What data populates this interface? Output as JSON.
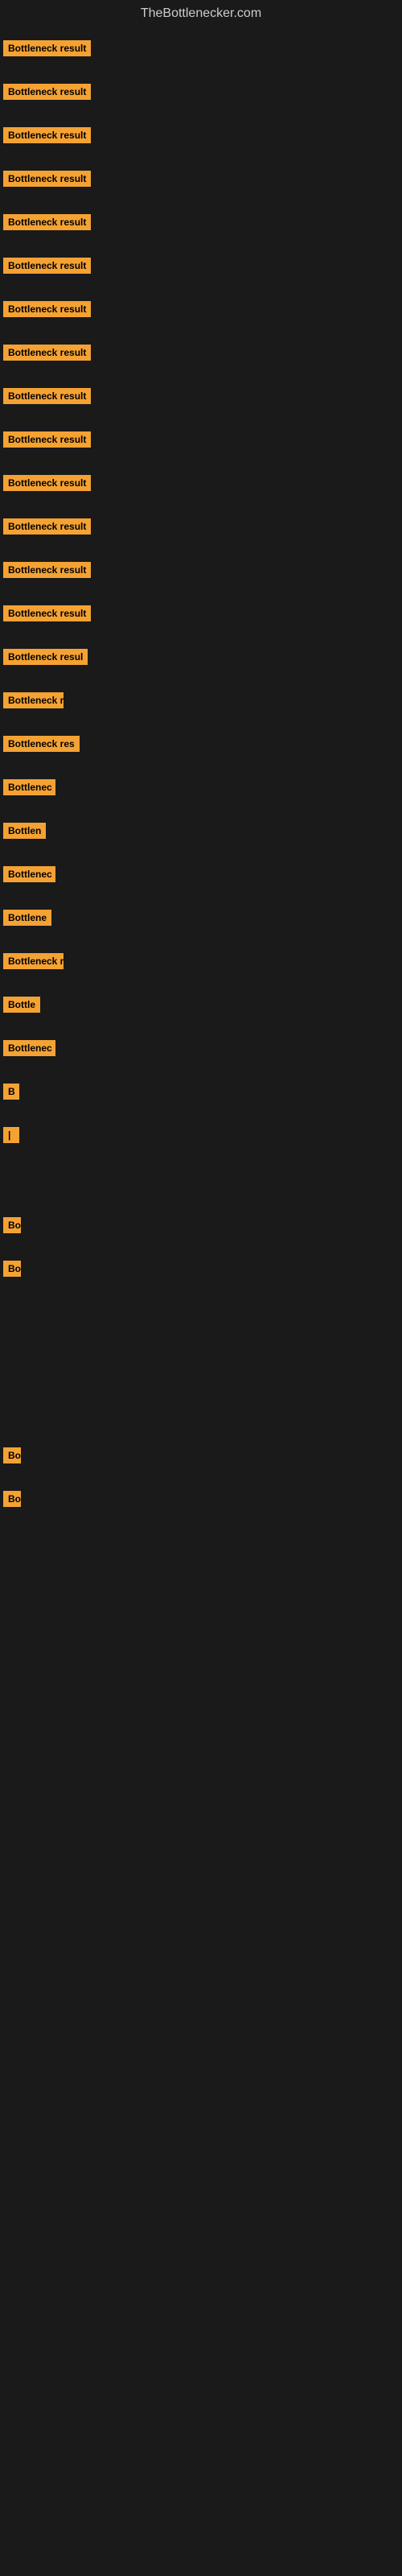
{
  "site": {
    "title": "TheBottlenecker.com"
  },
  "items": [
    {
      "id": 1,
      "label": "Bottleneck result",
      "width": "full",
      "row_class": "row-1"
    },
    {
      "id": 2,
      "label": "Bottleneck result",
      "width": "full",
      "row_class": "row-2"
    },
    {
      "id": 3,
      "label": "Bottleneck result",
      "width": "full",
      "row_class": "row-3"
    },
    {
      "id": 4,
      "label": "Bottleneck result",
      "width": "full",
      "row_class": "row-4"
    },
    {
      "id": 5,
      "label": "Bottleneck result",
      "width": "full",
      "row_class": "row-5"
    },
    {
      "id": 6,
      "label": "Bottleneck result",
      "width": "full",
      "row_class": "row-6"
    },
    {
      "id": 7,
      "label": "Bottleneck result",
      "width": "full",
      "row_class": "row-7"
    },
    {
      "id": 8,
      "label": "Bottleneck result",
      "width": "full",
      "row_class": "row-8"
    },
    {
      "id": 9,
      "label": "Bottleneck result",
      "width": "full",
      "row_class": "row-9"
    },
    {
      "id": 10,
      "label": "Bottleneck result",
      "width": "full",
      "row_class": "row-10"
    },
    {
      "id": 11,
      "label": "Bottleneck result",
      "width": "full",
      "row_class": "row-11"
    },
    {
      "id": 12,
      "label": "Bottleneck result",
      "width": "full",
      "row_class": "row-12"
    },
    {
      "id": 13,
      "label": "Bottleneck result",
      "width": "full",
      "row_class": "row-13"
    },
    {
      "id": 14,
      "label": "Bottleneck result",
      "width": "full",
      "row_class": "row-14"
    },
    {
      "id": 15,
      "label": "Bottleneck resul",
      "width": "partial",
      "row_class": "row-15"
    },
    {
      "id": 16,
      "label": "Bottleneck r",
      "width": "partial2",
      "row_class": "row-16"
    },
    {
      "id": 17,
      "label": "Bottleneck res",
      "width": "partial3",
      "row_class": "row-17"
    },
    {
      "id": 18,
      "label": "Bottlenec",
      "width": "partial4",
      "row_class": "row-18"
    },
    {
      "id": 19,
      "label": "Bottlen",
      "width": "partial5",
      "row_class": "row-19"
    },
    {
      "id": 20,
      "label": "Bottlenec",
      "width": "partial4",
      "row_class": "row-20"
    },
    {
      "id": 21,
      "label": "Bottlene",
      "width": "partial6",
      "row_class": "row-21"
    },
    {
      "id": 22,
      "label": "Bottleneck r",
      "width": "partial2",
      "row_class": "row-22"
    },
    {
      "id": 23,
      "label": "Bottle",
      "width": "partial7",
      "row_class": "row-23"
    },
    {
      "id": 24,
      "label": "Bottlenec",
      "width": "partial4",
      "row_class": "row-24"
    },
    {
      "id": 25,
      "label": "B",
      "width": "tiny",
      "row_class": "row-25"
    },
    {
      "id": 26,
      "label": "|",
      "width": "tiny2",
      "row_class": "row-26"
    },
    {
      "id": 27,
      "label": "Bo",
      "width": "tiny3",
      "row_class": "row-27"
    },
    {
      "id": 28,
      "label": "Bo",
      "width": "tiny3",
      "row_class": "row-28"
    },
    {
      "id": 29,
      "label": "Bo",
      "width": "tiny3",
      "row_class": "row-29"
    },
    {
      "id": 30,
      "label": "Bo",
      "width": "tiny3",
      "row_class": "row-30"
    }
  ]
}
